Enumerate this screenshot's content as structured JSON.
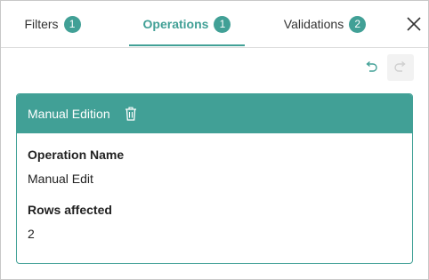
{
  "tabs": [
    {
      "label": "Filters",
      "count": "1"
    },
    {
      "label": "Operations",
      "count": "1"
    },
    {
      "label": "Validations",
      "count": "2"
    }
  ],
  "active_tab": "Operations",
  "colors": {
    "accent": "#41a096",
    "disabled": "#cfcfcf"
  },
  "icons": {
    "close": "close-icon",
    "undo": "undo-icon",
    "redo": "redo-icon",
    "trash": "trash-icon"
  },
  "card": {
    "title": "Manual Edition",
    "fields": [
      {
        "label": "Operation Name",
        "value": "Manual Edit"
      },
      {
        "label": "Rows affected",
        "value": "2"
      }
    ]
  }
}
